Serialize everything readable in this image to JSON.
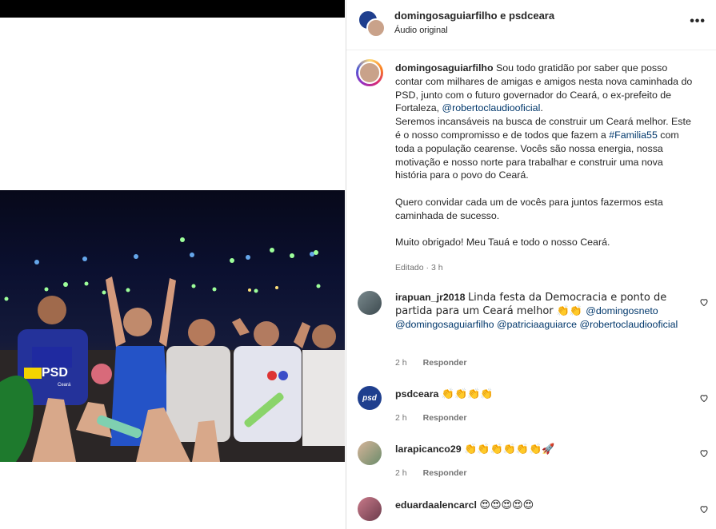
{
  "header": {
    "title": "domingosaguiarfilho e psdceara",
    "subtitle": "Áudio original",
    "more": "•••"
  },
  "media": {
    "shirt_badge": "PSD",
    "shirt_caption": "Ceará"
  },
  "caption": {
    "username": "domingosaguiarfilho",
    "p1_a": "Sou todo gratidão por saber que posso contar com milhares de amigas e amigos nesta nova caminhada do PSD, junto com o futuro governador do Ceará, o ex-prefeito de Fortaleza, ",
    "mention1": "@robertoclaudiooficial",
    "p1_b": ".",
    "p2_a": "Seremos incansáveis na busca de construir um Ceará melhor. Este é o nosso compromisso e de todos que fazem a ",
    "hashtag": "#Familia55",
    "p2_b": " com toda a população cearense. Vocês são nossa energia, nossa motivação e nosso norte para trabalhar e construir uma nova história para o povo do Ceará.",
    "p3": "Quero convidar cada um de vocês para juntos fazermos esta caminhada de sucesso.",
    "p4": "Muito obrigado! Meu Tauá e todo o nosso Ceará.",
    "meta": "Editado · 3 h"
  },
  "comments": [
    {
      "username": "irapuan_jr2018",
      "text": "Linda festa da Democracia e ponto de partida para um Ceará melhor 👏👏 ",
      "m1": "@domingosneto",
      "m2": "@domingosaguiarfilho",
      "m3": "@patriciaaguiarce",
      "m4": "@robertoclaudiooficial",
      "time": "2 h",
      "reply": "Responder"
    },
    {
      "username": "psdceara",
      "text": "👏👏👏👏",
      "avatar_text": "psd",
      "time": "2 h",
      "reply": "Responder"
    },
    {
      "username": "larapicanco29",
      "text": "👏👏👏👏👏👏🚀",
      "time": "2 h",
      "reply": "Responder"
    },
    {
      "username": "eduardaalencarcl",
      "text": "😍😍😍😍😍"
    }
  ],
  "colors": {
    "link": "#00376b",
    "meta": "#737373",
    "psd_blue": "#1f3f8e"
  }
}
